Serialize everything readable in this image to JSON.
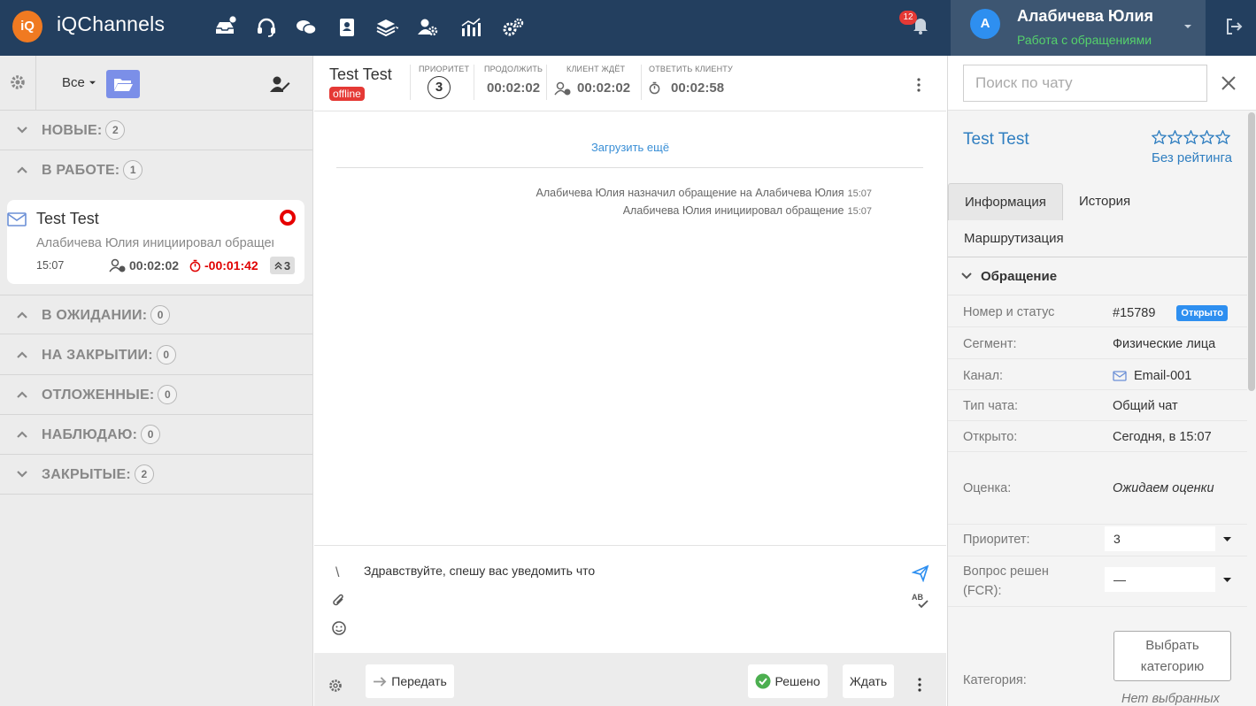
{
  "app": {
    "logo_text": "iQ",
    "brand": "iQChannels",
    "notifications_count": "12",
    "user": {
      "avatar_letter": "А",
      "name": "Алабичева Юлия",
      "status": "Работа с обращениями"
    }
  },
  "left_panel": {
    "filter_label": "Все",
    "sections": [
      {
        "id": "new",
        "label": "НОВЫЕ:",
        "count": "2",
        "expanded": false
      },
      {
        "id": "in_work",
        "label": "В РАБОТЕ:",
        "count": "1",
        "expanded": true
      },
      {
        "id": "waiting",
        "label": "В ОЖИДАНИИ:",
        "count": "0",
        "expanded": true
      },
      {
        "id": "closing",
        "label": "НА ЗАКРЫТИИ:",
        "count": "0",
        "expanded": true
      },
      {
        "id": "postponed",
        "label": "ОТЛОЖЕННЫЕ:",
        "count": "0",
        "expanded": true
      },
      {
        "id": "watching",
        "label": "НАБЛЮДАЮ:",
        "count": "0",
        "expanded": true
      },
      {
        "id": "closed",
        "label": "ЗАКРЫТЫЕ:",
        "count": "2",
        "expanded": false
      }
    ],
    "card": {
      "name": "Test Test",
      "last_message": "Алабичева Юлия инициировал обращение",
      "time": "15:07",
      "wait_time": "00:02:02",
      "overdue_time": "-00:01:42",
      "priority": "3"
    }
  },
  "center": {
    "client_name": "Test Test",
    "client_status": "offline",
    "metrics": {
      "priority_label": "ПРИОРИТЕТ",
      "priority_value": "3",
      "continue_label": "ПРОДОЛЖИТЬ",
      "continue_value": "00:02:02",
      "client_waits_label": "КЛИЕНТ ЖДЁТ",
      "client_waits_value": "00:02:02",
      "answer_label": "ОТВЕТИТЬ КЛИЕНТУ",
      "answer_value": "00:02:58"
    },
    "load_more": "Загрузить ещё",
    "system_messages": [
      {
        "text": "Алабичева Юлия назначил обращение на Алабичева Юлия",
        "time": "15:07"
      },
      {
        "text": "Алабичева Юлия инициировал обращение",
        "time": "15:07"
      }
    ],
    "composer": {
      "slash": "\\",
      "draft": "Здравствуйте, спешу вас уведомить что"
    },
    "actions": {
      "transfer": "Передать",
      "resolved": "Решено",
      "wait": "Ждать"
    }
  },
  "right_panel": {
    "search_placeholder": "Поиск по чату",
    "client_name": "Test Test",
    "rating_label": "Без рейтинга",
    "tabs": [
      "Информация",
      "История",
      "Маршрутизация"
    ],
    "section_title": "Обращение",
    "fields": {
      "number_status": {
        "label": "Номер и статус",
        "number": "#15789",
        "status": "Открыто"
      },
      "segment": {
        "label": "Сегмент:",
        "value": "Физические лица"
      },
      "channel": {
        "label": "Канал:",
        "value": "Email-001"
      },
      "chat_type": {
        "label": "Тип чата:",
        "value": "Общий чат"
      },
      "opened": {
        "label": "Открыто:",
        "value": "Сегодня, в 15:07"
      },
      "rating": {
        "label": "Оценка:",
        "value": "Ожидаем оценки"
      },
      "priority": {
        "label": "Приоритет:",
        "value": "3"
      },
      "fcr_line1": "Вопрос решен",
      "fcr_line2": "(FCR):",
      "fcr_value": "—",
      "category": {
        "label": "Категория:",
        "button_line1": "Выбрать",
        "button_line2": "категорию",
        "empty": "Нет выбранных"
      }
    }
  },
  "colors": {
    "topbar": "#233f5f",
    "user_panel": "#3d5672",
    "accent_blue": "#2e8ff0",
    "link_blue": "#2f7ec0",
    "danger_red": "#e53935",
    "success_green": "#55d26b"
  }
}
